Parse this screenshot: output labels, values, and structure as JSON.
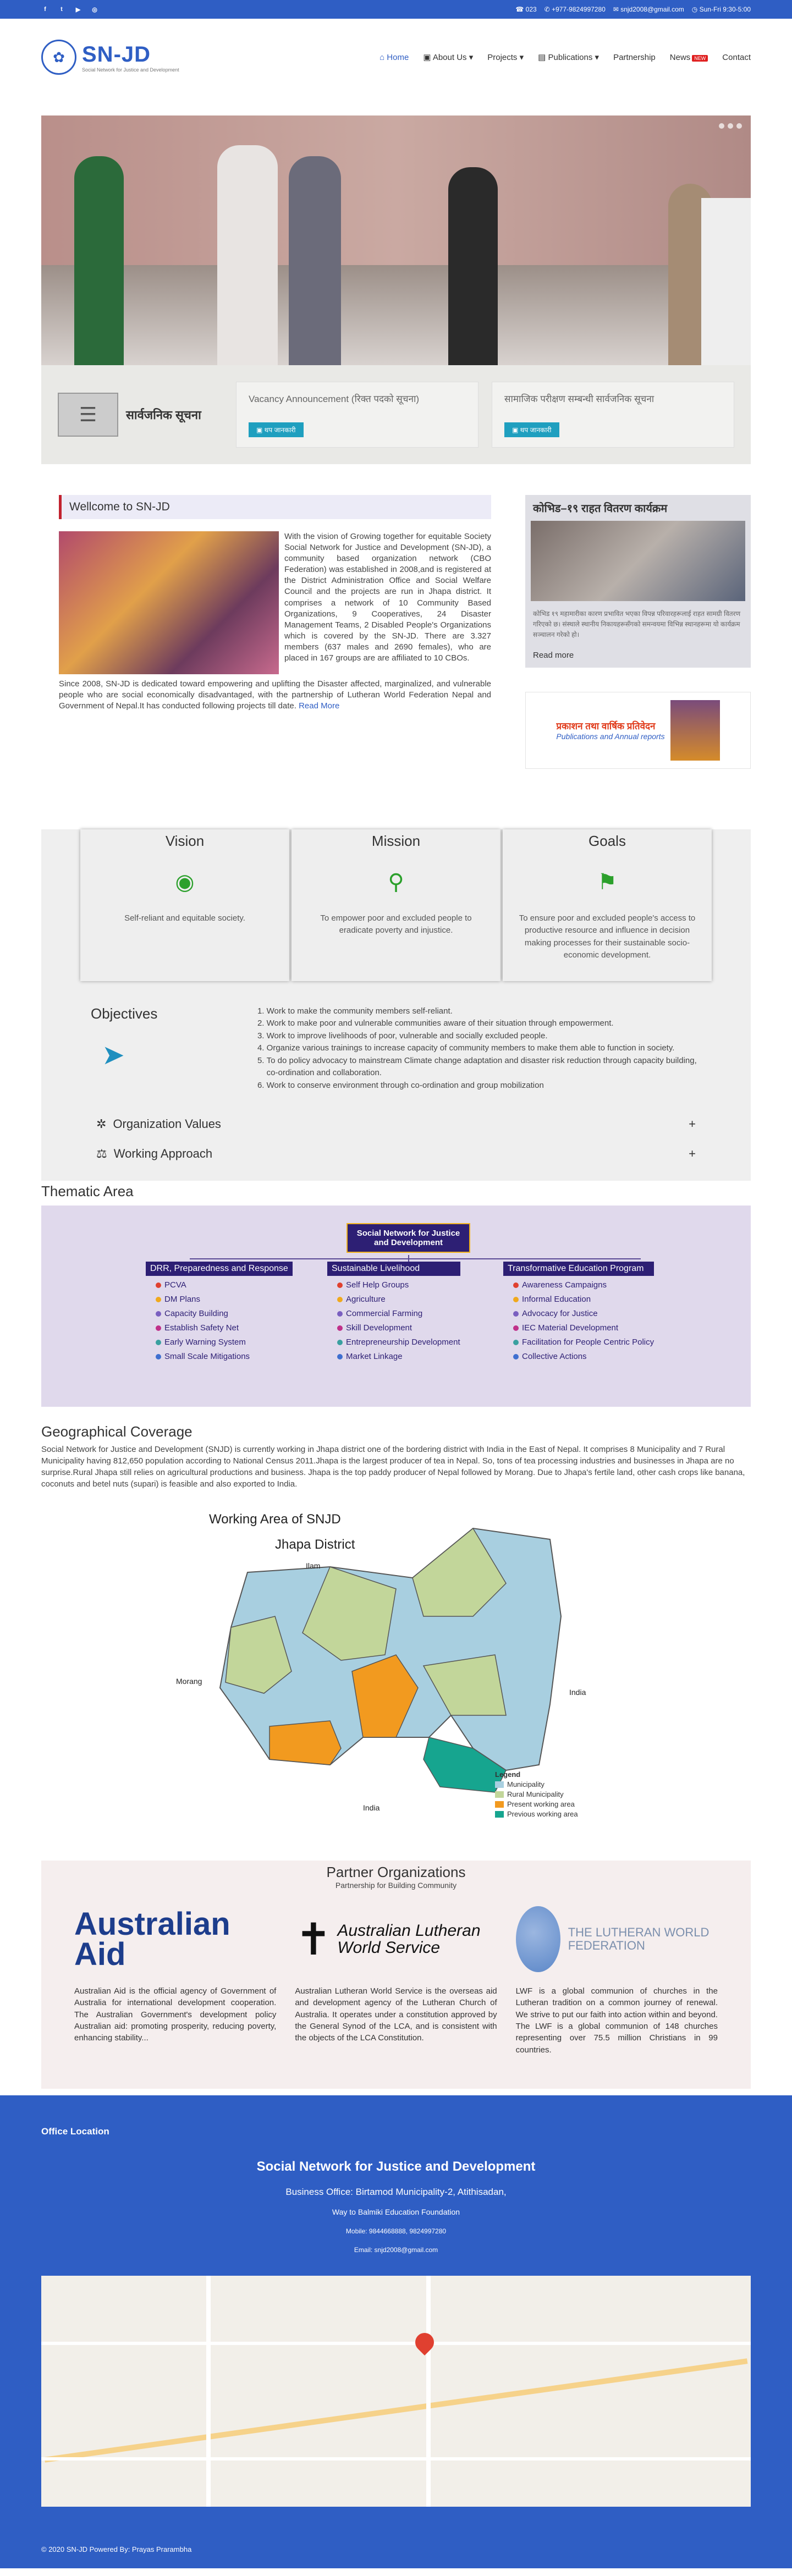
{
  "topbar": {
    "phone": "023",
    "mobile": "+977-9824997280",
    "email": "snjd2008@gmail.com",
    "hours": "Sun-Fri 9:30-5:00",
    "social": [
      "f",
      "t",
      "▶",
      "◎"
    ]
  },
  "header": {
    "logo_name": "SN-JD",
    "logo_tagline": "Social Network for Justice and Development",
    "nav": {
      "home": "Home",
      "about": "About Us",
      "projects": "Projects",
      "publications": "Publications",
      "partnership": "Partnership",
      "news": "News",
      "new_badge": "NEW",
      "contact": "Contact"
    }
  },
  "notices": {
    "title": "सार्वजनिक सूचना",
    "cards": [
      {
        "title": "Vacancy Announcement (रिक्त पदको सूचना)",
        "button": "थप जानकारी"
      },
      {
        "title": "सामाजिक परीक्षण सम्बन्धी सार्वजनिक सूचना",
        "button": "थप जानकारी"
      }
    ]
  },
  "welcome": {
    "title": "Wellcome to SN-JD",
    "para1": "With the vision of Growing together for equitable Society Social Network for Justice and Development (SN-JD), a community based organization network (CBO Federation) was established in 2008,and is registered at the District Administration Office and Social Welfare Council and the projects are run in Jhapa district. It comprises a network of 10 Community Based Organizations, 9 Cooperatives, 24 Disaster Management Teams, 2 Disabled People's Organizations which is covered by the SN-JD. There are 3.327 members (637 males and 2690 females), who are placed in 167 groups are are affiliated to 10 CBOs.",
    "para2": "Since 2008, SN-JD is dedicated toward empowering and uplifting the Disaster affected, marginalized, and vulnerable people who are social economically disadvantaged, with the partnership of Lutheran World Federation Nepal and Government of Nepal.It has conducted following projects till date.",
    "read_more": "Read More"
  },
  "side": {
    "title": "कोभिड–१९ राहत वितरण कार्यक्रम",
    "text": "कोभिड १९ महामारीका कारण प्रभावित भएका विपन्न परिवारहरूलाई राहत सामग्री वितरण गरिएको छ। संस्थाले स्थानीय निकायहरूसँगको समन्वयमा विभिन्न स्थानहरूमा यो कार्यक्रम सञ्चालन गरेको हो।",
    "read_more": "Read more",
    "pub_np": "प्रकाशन तथा वार्षिक प्रतिवेदन",
    "pub_en": "Publications and Annual reports"
  },
  "vmg": [
    {
      "title": "Vision",
      "icon": "eye-icon",
      "glyph": "◉",
      "text": "Self-reliant and equitable society."
    },
    {
      "title": "Mission",
      "icon": "bulb-icon",
      "glyph": "⚲",
      "text": "To empower poor and excluded people to eradicate poverty and injustice."
    },
    {
      "title": "Goals",
      "icon": "flag-icon",
      "glyph": "⚑",
      "text": "To ensure poor and excluded people's access to productive resource and influence in decision making processes for their sustainable socio-economic development."
    }
  ],
  "objectives": {
    "title": "Objectives",
    "items": [
      "Work to make the community members self-reliant.",
      "Work to make poor and vulnerable communities aware of their situation through empowerment.",
      "Work to improve livelihoods of poor, vulnerable and socially excluded people.",
      "Organize various trainings to increase capacity of community members to make them able to function in society.",
      "To do policy advocacy to mainstream Climate change adaptation and disaster risk reduction through capacity building, co-ordination and collaboration.",
      "Work to conserve environment through co-ordination and group mobilization"
    ]
  },
  "accordion": [
    {
      "label": "Organization Values",
      "icon": "gear-icon",
      "glyph": "✲"
    },
    {
      "label": "Working Approach",
      "icon": "scale-icon",
      "glyph": "⚖"
    }
  ],
  "thematic": {
    "title": "Thematic Area",
    "root": "Social Network for Justice and Development",
    "columns": [
      {
        "head": "DRR, Preparedness and Response",
        "items": [
          "PCVA",
          "DM Plans",
          "Capacity Building",
          "Establish Safety Net",
          "Early Warning System",
          "Small Scale Mitigations"
        ]
      },
      {
        "head": "Sustainable Livelihood",
        "items": [
          "Self Help Groups",
          "Agriculture",
          "Commercial Farming",
          "Skill Development",
          "Entrepreneurship Development",
          "Market Linkage"
        ]
      },
      {
        "head": "Transformative Education Program",
        "items": [
          "Awareness Campaigns",
          "Informal Education",
          "Advocacy for Justice",
          "IEC Material Development",
          "Facilitation for People Centric Policy",
          "Collective Actions"
        ]
      }
    ],
    "dot_colors": [
      "#e0412f",
      "#f0a91d",
      "#7a5fc0",
      "#c0308a",
      "#3aa0a0",
      "#3f6fd0"
    ]
  },
  "geo": {
    "title": "Geographical Coverage",
    "text": "Social Network for Justice and Development (SNJD) is currently working in Jhapa district one of the bordering district with India in the East of Nepal. It comprises 8 Municipality and 7 Rural Municipality having 812,650 population according to National Census 2011.Jhapa is the largest producer of tea in Nepal. So, tons of tea processing industries and businesses in Jhapa are no surprise.Rural Jhapa still relies on agricultural productions and business. Jhapa is the top paddy producer of Nepal followed by Morang. Due to Jhapa's fertile land, other cash crops like banana, coconuts and betel nuts (supari) is feasible and also exported to India.",
    "map_title": "Working Area of SNJD",
    "map_subtitle": "Jhapa District",
    "labels": {
      "ilam": "Ilam",
      "morang": "Morang",
      "india_e": "India",
      "india_s": "India"
    },
    "legend_title": "Legend",
    "legend": [
      {
        "label": "Municipality",
        "color": "#a8cfe0"
      },
      {
        "label": "Rural Municipality",
        "color": "#c2d69a"
      },
      {
        "label": "Present working area",
        "color": "#f29a1f"
      },
      {
        "label": "Previous working area",
        "color": "#16a58f"
      }
    ]
  },
  "partners": {
    "title": "Partner Organizations",
    "subtitle": "Partnership for Building Community",
    "items": [
      {
        "logo": "Australian Aid",
        "text": "Australian Aid is the official agency of Government of Australia for international development cooperation. The Australian Government's development policy Australian aid: promoting prosperity, reducing poverty, enhancing stability..."
      },
      {
        "logo": "Australian Lutheran World Service",
        "text": "Australian Lutheran World Service is the overseas aid and development agency of the Lutheran Church of Australia. It operates under a constitution approved by the General Synod of the LCA, and is consistent with the objects of the LCA Constitution."
      },
      {
        "logo": "THE LUTHERAN WORLD FEDERATION",
        "text": "LWF is a global communion of churches in the Lutheran tradition on a common journey of renewal. We strive to put our faith into action within and beyond. The LWF is a global communion of 148 churches representing over 75.5 million Christians in 99 countries."
      }
    ]
  },
  "footer": {
    "office_location": "Office Location",
    "org": "Social Network for Justice and Development",
    "address": "Business Office: Birtamod Municipality-2, Atithisadan,",
    "way": "Way to Balmiki Education Foundation",
    "mobile": "Mobile: 9844668888, 9824997280",
    "email": "Email: snjd2008@gmail.com",
    "copyright": "© 2020 SN-JD Powered By: Prayas Prarambha"
  }
}
